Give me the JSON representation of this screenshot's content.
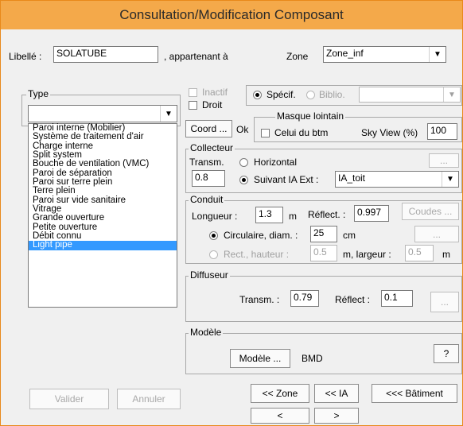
{
  "window": {
    "title": "Consultation/Modification Composant"
  },
  "header": {
    "libelle_label": "Libellé :",
    "libelle_value": "SOLATUBE",
    "appartenant_label": ", appartenant à",
    "zone_label": "Zone",
    "zone_value": "Zone_inf"
  },
  "type_group": {
    "legend": "Type",
    "selected_value": "",
    "options": [
      "Paroi interne (Mobilier)",
      "Système de traitement d'air",
      "Charge interne",
      "Split system",
      "Bouche de ventilation (VMC)",
      "Paroi de séparation",
      "Paroi sur terre plein",
      "Terre plein",
      "Paroi sur vide sanitaire",
      "Vitrage",
      "Grande ouverture",
      "Petite ouverture",
      "Débit connu",
      "Light pipe"
    ],
    "selected_index": 13
  },
  "flags": {
    "inactif_label": "Inactif",
    "droit_label": "Droit",
    "specif_label": "Spécif.",
    "biblio_label": "Biblio.",
    "biblio_value": ""
  },
  "coord": {
    "button_label": "Coord ...",
    "status": "Ok"
  },
  "masque": {
    "legend": "Masque lointain",
    "celui_label": "Celui du btm",
    "skyview_label": "Sky View (%)",
    "skyview_value": "100"
  },
  "collecteur": {
    "legend": "Collecteur",
    "transm_label": "Transm.",
    "transm_value": "0.8",
    "horizontal_label": "Horizontal",
    "suivant_label": "Suivant IA Ext :",
    "suivant_value": "IA_toit",
    "dots_button": "..."
  },
  "conduit": {
    "legend": "Conduit",
    "longueur_label": "Longueur :",
    "longueur_value": "1.3",
    "longueur_unit": "m",
    "reflect_label": "Réflect. :",
    "reflect_value": "0.997",
    "coudes_button": "Coudes ...",
    "circulaire_label": "Circulaire, diam. :",
    "diam_value": "25",
    "diam_unit": "cm",
    "rect_label": "Rect., hauteur :",
    "hauteur_value": "0.5",
    "largeur_label": "m, largeur :",
    "largeur_value": "0.5",
    "largeur_unit": "m",
    "dots_button": "..."
  },
  "diffuseur": {
    "legend": "Diffuseur",
    "transm_label": "Transm. :",
    "transm_value": "0.79",
    "reflect_label": "Réflect :",
    "reflect_value": "0.1",
    "dots_button": "..."
  },
  "modele": {
    "legend": "Modèle",
    "button_label": "Modèle ...",
    "value": "BMD",
    "help_button": "?"
  },
  "nav": {
    "zone_button": "<< Zone",
    "ia_button": "<< IA",
    "batiment_button": "<<< Bâtiment",
    "prev_button": "<",
    "next_button": ">"
  },
  "footer": {
    "valider_button": "Valider",
    "annuler_button": "Annuler"
  }
}
